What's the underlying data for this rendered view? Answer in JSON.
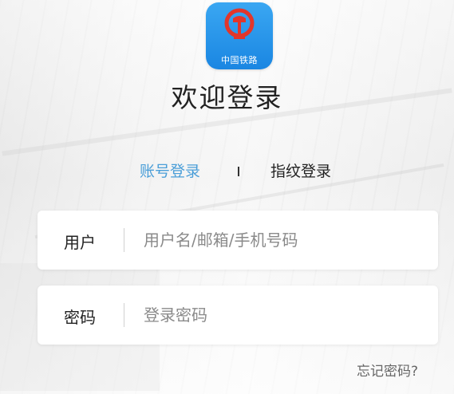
{
  "app_icon": {
    "label": "中国铁路",
    "name": "china-railway-logo"
  },
  "title": "欢迎登录",
  "tabs": [
    {
      "label": "账号登录",
      "active": true
    },
    {
      "label": "指纹登录",
      "active": false
    }
  ],
  "fields": {
    "username": {
      "label": "用户",
      "value": "",
      "placeholder": "用户名/邮箱/手机号码"
    },
    "password": {
      "label": "密码",
      "value": "",
      "placeholder": "登录密码"
    }
  },
  "forgot_password": "忘记密码?",
  "colors": {
    "accent": "#4a9ed8",
    "icon_bg": "#1a86e2",
    "logo_red": "#e2362b"
  }
}
